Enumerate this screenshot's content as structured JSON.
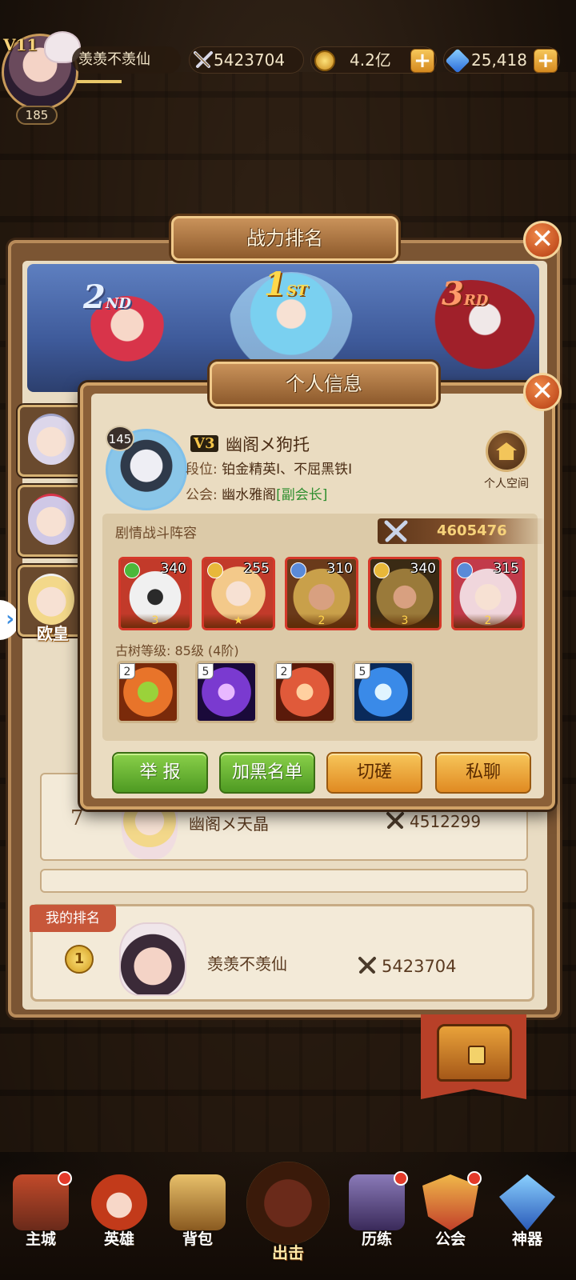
{
  "player": {
    "vip": "V11",
    "level": "185",
    "name": "羡羡不羡仙"
  },
  "resources": {
    "power": "5423704",
    "gold": "4.2亿",
    "gems": "25,418",
    "plus": "+"
  },
  "ranking_panel": {
    "title": "战力排名",
    "close": "✕",
    "podium": {
      "second": "2",
      "second_suffix": "ND",
      "first": "1",
      "first_suffix": "ST",
      "third": "3",
      "third_suffix": "RD"
    },
    "rows": [
      {
        "rank": "7",
        "name": "幽阁メ天晶",
        "power": "4512299"
      }
    ],
    "left_badge": "欧皇",
    "my_rank": {
      "tag": "我的排名",
      "rank": "1",
      "name": "羡羡不羡仙",
      "power": "5423704"
    }
  },
  "info_dialog": {
    "title": "个人信息",
    "close": "✕",
    "level": "145",
    "vip": "V3",
    "name": "幽阁メ狗托",
    "rank_label": "段位:",
    "rank_value": "铂金精英Ⅰ、不屈黑铁Ⅰ",
    "guild_label": "公会:",
    "guild_name": "幽水雅阁",
    "guild_role": "[副会长]",
    "home_label": "个人空间",
    "lineup_title": "剧情战斗阵容",
    "lineup_power": "4605476",
    "heroes": [
      {
        "level": "340",
        "stars": "3",
        "element_color": "#4cb83a",
        "art": "#e8e8e8"
      },
      {
        "level": "255",
        "stars": "★",
        "element_color": "#e8b83a",
        "art": "#f3c98a"
      },
      {
        "level": "310",
        "stars": "2",
        "element_color": "#5a8ad8",
        "art": "#c9a04a"
      },
      {
        "level": "340",
        "stars": "3",
        "element_color": "#e8b83a",
        "art": "#9a7a3a"
      },
      {
        "level": "315",
        "stars": "2",
        "element_color": "#5a8ad8",
        "art": "#f0d6dc"
      }
    ],
    "tree_label": "古树等级: 85级 (4阶)",
    "skills": [
      {
        "count": "2",
        "color": "#e8742a"
      },
      {
        "count": "5",
        "color": "#7a3ad0"
      },
      {
        "count": "2",
        "color": "#e05a3a"
      },
      {
        "count": "5",
        "color": "#3a8ae8"
      }
    ],
    "buttons": {
      "report": "举 报",
      "blacklist": "加黑名单",
      "duel": "切磋",
      "chat": "私聊"
    }
  },
  "bottom_nav": [
    {
      "label": "主城"
    },
    {
      "label": "英雄"
    },
    {
      "label": "背包"
    },
    {
      "label": "出击"
    },
    {
      "label": "历练"
    },
    {
      "label": "公会"
    },
    {
      "label": "神器"
    }
  ]
}
